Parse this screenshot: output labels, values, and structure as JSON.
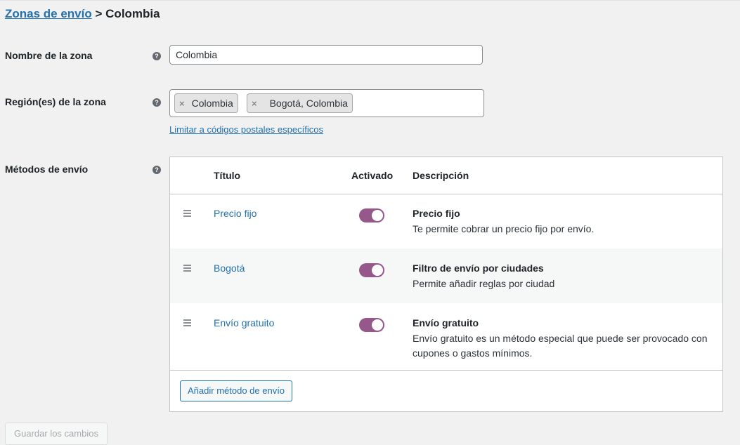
{
  "breadcrumb": {
    "zones_link": "Zonas de envío",
    "separator": ">",
    "current": "Colombia"
  },
  "fields": {
    "zone_name_label": "Nombre de la zona",
    "zone_name_value": "Colombia",
    "regions_label": "Región(es) de la zona",
    "regions": [
      "Colombia",
      "Bogotá, Colombia"
    ],
    "chip_remove": "×",
    "postal_link": "Limitar a códigos postales específicos",
    "methods_label": "Métodos de envío",
    "help_glyph": "?"
  },
  "table": {
    "headers": {
      "title": "Título",
      "enabled": "Activado",
      "description": "Descripción"
    },
    "rows": [
      {
        "title": "Precio fijo",
        "enabled": true,
        "desc_title": "Precio fijo",
        "desc": "Te permite cobrar un precio fijo por envío."
      },
      {
        "title": "Bogotá",
        "enabled": true,
        "desc_title": "Filtro de envío por ciudades",
        "desc": "Permite añadir reglas por ciudad"
      },
      {
        "title": "Envío gratuito",
        "enabled": true,
        "desc_title": "Envío gratuito",
        "desc": "Envío gratuito es un método especial que puede ser provocado con cupones o gastos mínimos."
      }
    ],
    "add_button": "Añadir método de envío"
  },
  "save_button": "Guardar los cambios",
  "colors": {
    "link": "#2271b1",
    "toggle_on": "#96588a"
  }
}
